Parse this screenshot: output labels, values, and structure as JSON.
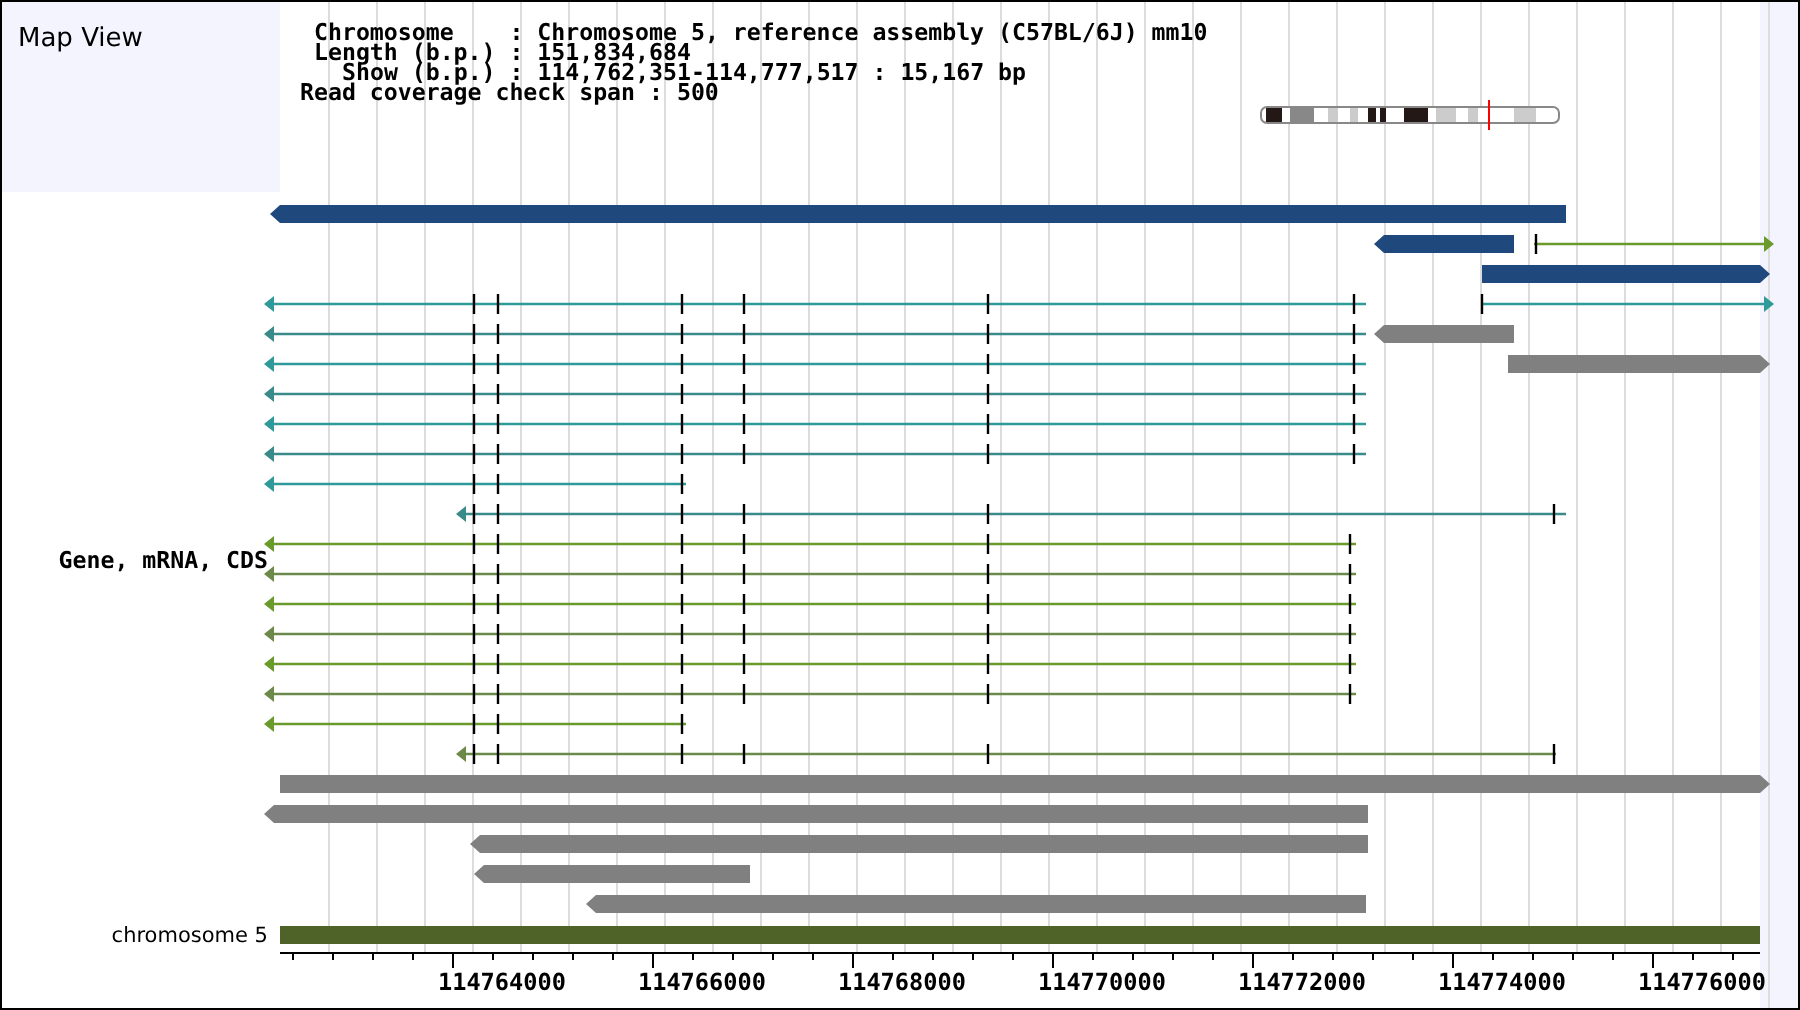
{
  "panel": {
    "title": "Map View"
  },
  "header": {
    "lines": [
      "Chromosome    : Chromosome 5, reference assembly (C57BL/6J) mm10",
      "Length (b.p.) : 151,834,684",
      "Show (b.p.) : 114,762,351-114,777,517 : 15,167 bp",
      "Read coverage check span : 500"
    ]
  },
  "track_label": "Gene, mRNA, CDS",
  "rows": [
    {
      "features": [
        {
          "kind": "bar",
          "color": "#1f497d",
          "points_left": true,
          "points_right": false
        }
      ]
    },
    {
      "features": [
        {
          "kind": "bar",
          "color": "#1f497d",
          "points_left": true,
          "points_right": false
        },
        {
          "kind": "line",
          "color": "#6b9a2c",
          "points_left": false,
          "points_right": true
        }
      ]
    },
    {
      "features": [
        {
          "kind": "bar",
          "color": "#1f497d",
          "points_left": false,
          "points_right": true
        }
      ]
    },
    {
      "features": [
        {
          "kind": "line",
          "color": "#2f9a9a",
          "points_left": true,
          "points_right": false
        },
        {
          "kind": "line",
          "color": "#2f9a9a",
          "points_left": false,
          "points_right": true
        }
      ]
    },
    {
      "features": [
        {
          "kind": "line",
          "color": "#3a8a8a",
          "points_left": true,
          "points_right": false
        },
        {
          "kind": "bar",
          "color": "#808080",
          "points_left": true,
          "points_right": false
        }
      ]
    },
    {
      "features": [
        {
          "kind": "line",
          "color": "#2f9a9a",
          "points_left": true,
          "points_right": false
        },
        {
          "kind": "bar",
          "color": "#808080",
          "points_left": false,
          "points_right": true
        }
      ]
    },
    {
      "features": [
        {
          "kind": "line",
          "color": "#3a8a8a",
          "points_left": true,
          "points_right": false
        }
      ]
    },
    {
      "features": [
        {
          "kind": "line",
          "color": "#2f9a9a",
          "points_left": true,
          "points_right": false
        }
      ]
    },
    {
      "features": [
        {
          "kind": "line",
          "color": "#3a8a8a",
          "points_left": true,
          "points_right": false
        }
      ]
    },
    {
      "features": [
        {
          "kind": "line",
          "color": "#2f9a9a",
          "points_left": true,
          "points_right": false
        }
      ]
    },
    {
      "features": [
        {
          "kind": "line",
          "color": "#3a8a8a",
          "points_left": true,
          "points_right": false
        }
      ]
    },
    {
      "features": [
        {
          "kind": "line",
          "color": "#6b9a2c",
          "points_left": true,
          "points_right": false
        }
      ]
    },
    {
      "features": [
        {
          "kind": "line",
          "color": "#6b8a4a",
          "points_left": true,
          "points_right": false
        }
      ]
    },
    {
      "features": [
        {
          "kind": "line",
          "color": "#6b9a2c",
          "points_left": true,
          "points_right": false
        }
      ]
    },
    {
      "features": [
        {
          "kind": "line",
          "color": "#6b8a4a",
          "points_left": true,
          "points_right": false
        }
      ]
    },
    {
      "features": [
        {
          "kind": "line",
          "color": "#6b9a2c",
          "points_left": true,
          "points_right": false
        }
      ]
    },
    {
      "features": [
        {
          "kind": "line",
          "color": "#6b8a4a",
          "points_left": true,
          "points_right": false
        }
      ]
    },
    {
      "features": [
        {
          "kind": "line",
          "color": "#6b9a2c",
          "points_left": true,
          "points_right": false
        }
      ]
    },
    {
      "features": [
        {
          "kind": "line",
          "color": "#6b8a4a",
          "points_left": true,
          "points_right": false
        }
      ]
    },
    {
      "features": [
        {
          "kind": "bar",
          "color": "#808080",
          "points_left": false,
          "points_right": true
        }
      ]
    },
    {
      "features": [
        {
          "kind": "bar",
          "color": "#808080",
          "points_left": true,
          "points_right": false
        }
      ]
    },
    {
      "features": [
        {
          "kind": "bar",
          "color": "#808080",
          "points_left": true,
          "points_right": false
        }
      ]
    },
    {
      "features": [
        {
          "kind": "bar",
          "color": "#808080",
          "points_left": true,
          "points_right": false
        }
      ]
    },
    {
      "features": [
        {
          "kind": "bar",
          "color": "#808080",
          "points_left": true,
          "points_right": false
        }
      ]
    }
  ],
  "chromosome_track": {
    "label": "chromosome 5"
  },
  "axis": {
    "labels": [
      "114764000",
      "114766000",
      "114768000",
      "114770000",
      "114772000",
      "114774000",
      "114776000"
    ]
  }
}
